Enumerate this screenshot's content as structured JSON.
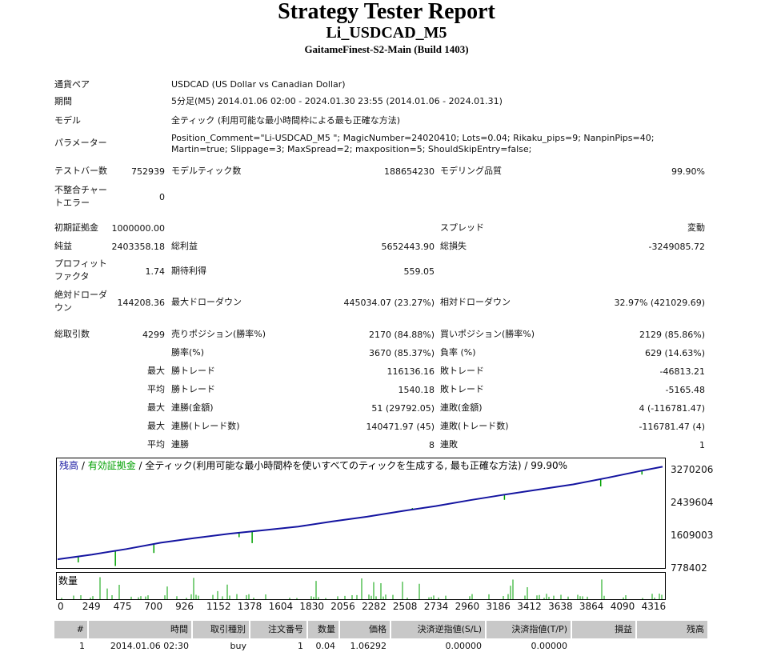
{
  "header": {
    "title": "Strategy Tester Report",
    "subtitle": "Li_USDCAD_M5",
    "server": "GaitameFinest-S2-Main (Build 1403)"
  },
  "info": {
    "symbol_label": "通貨ペア",
    "symbol_value": "USDCAD (US Dollar vs Canadian Dollar)",
    "period_label": "期間",
    "period_value": "5分足(M5) 2014.01.06 02:00 - 2024.01.30 23:55 (2014.01.06 - 2024.01.31)",
    "model_label": "モデル",
    "model_value": "全ティック (利用可能な最小時間枠による最も正確な方法)",
    "params_label": "パラメーター",
    "params_value": "Position_Comment=\"Li-USDCAD_M5 \"; MagicNumber=24020410; Lots=0.04; Rikaku_pips=9; NanpinPips=40; Martin=true; Slippage=3; MaxSpread=2; maxposition=5; ShouldSkipEntry=false;"
  },
  "stats": {
    "bars_label": "テストバー数",
    "bars_value": "752939",
    "ticks_label": "モデルティック数",
    "ticks_value": "188654230",
    "quality_label": "モデリング品質",
    "quality_value": "99.90%",
    "mismatch_label": "不整合チャートエラー",
    "mismatch_value": "0",
    "deposit_label": "初期証拠金",
    "deposit_value": "1000000.00",
    "spread_label": "スプレッド",
    "spread_value": "変動",
    "net_label": "純益",
    "net_value": "2403358.18",
    "gross_profit_label": "総利益",
    "gross_profit_value": "5652443.90",
    "gross_loss_label": "総損失",
    "gross_loss_value": "-3249085.72",
    "pf_label": "プロフィットファクタ",
    "pf_value": "1.74",
    "expected_label": "期待利得",
    "expected_value": "559.05",
    "abs_dd_label": "絶対ドローダウン",
    "abs_dd_value": "144208.36",
    "max_dd_label": "最大ドローダウン",
    "max_dd_value": "445034.07 (23.27%)",
    "rel_dd_label": "相対ドローダウン",
    "rel_dd_value": "32.97% (421029.69)",
    "trades_label": "総取引数",
    "trades_value": "4299",
    "short_label": "売りポジション(勝率%)",
    "short_value": "2170 (84.88%)",
    "long_label": "買いポジション(勝率%)",
    "long_value": "2129 (85.86%)",
    "win_pct_label": "勝率(%)",
    "win_pct_value": "3670 (85.37%)",
    "loss_pct_label": "負率 (%)",
    "loss_pct_value": "629 (14.63%)",
    "max_prefix": "最大",
    "avg_prefix": "平均",
    "largest_win_label": "勝トレード",
    "largest_win_value": "116136.16",
    "largest_loss_label": "敗トレード",
    "largest_loss_value": "-46813.21",
    "avg_win_label": "勝トレード",
    "avg_win_value": "1540.18",
    "avg_loss_label": "敗トレード",
    "avg_loss_value": "-5165.48",
    "max_cons_wins_label": "連勝(金額)",
    "max_cons_wins_value": "51 (29792.05)",
    "max_cons_losses_label": "連敗(金額)",
    "max_cons_losses_value": "4 (-116781.47)",
    "max_cons_profit_label": "連勝(トレード数)",
    "max_cons_profit_value": "140471.97 (45)",
    "max_cons_loss_label": "連敗(トレード数)",
    "max_cons_loss_value": "-116781.47 (4)",
    "avg_cons_wins_label": "連勝",
    "avg_cons_wins_value": "8",
    "avg_cons_losses_label": "連敗",
    "avg_cons_losses_value": "1"
  },
  "chart_data": {
    "type": "line",
    "legend": {
      "balance": "残高",
      "separator": " / ",
      "equity": "有効証拠金",
      "model": " / 全ティック(利用可能な最小時間枠を使いすべてのティックを生成する, 最も正確な方法) / 99.90%"
    },
    "volume_label": "数量",
    "y_ticks": [
      3270206,
      2439604,
      1609003,
      778402
    ],
    "ylim": [
      778402,
      3500000
    ],
    "x_ticks": [
      0,
      249,
      475,
      700,
      926,
      1152,
      1378,
      1604,
      1830,
      2056,
      2282,
      2508,
      2734,
      2960,
      3186,
      3412,
      3638,
      3864,
      4090,
      4316
    ],
    "xlim": [
      0,
      4400
    ],
    "series": [
      {
        "name": "残高",
        "color": "#1414a0",
        "x": [
          0,
          250,
          500,
          750,
          1000,
          1250,
          1500,
          1750,
          2000,
          2250,
          2500,
          2750,
          3000,
          3250,
          3500,
          3750,
          4000,
          4250,
          4400
        ],
        "values": [
          1000000,
          1120000,
          1260000,
          1420000,
          1540000,
          1650000,
          1740000,
          1830000,
          1960000,
          2080000,
          2220000,
          2350000,
          2500000,
          2640000,
          2770000,
          2900000,
          3070000,
          3250000,
          3350000
        ]
      },
      {
        "name": "有効証拠金",
        "color": "#00a000",
        "dips": [
          {
            "x": 150,
            "y": 920000
          },
          {
            "x": 420,
            "y": 830000
          },
          {
            "x": 700,
            "y": 1160000
          },
          {
            "x": 1320,
            "y": 1560000
          },
          {
            "x": 1415,
            "y": 1410000
          },
          {
            "x": 2260,
            "y": 2080000
          },
          {
            "x": 2580,
            "y": 2300000
          },
          {
            "x": 3250,
            "y": 2510000
          },
          {
            "x": 3950,
            "y": 2850000
          },
          {
            "x": 4250,
            "y": 3150000
          }
        ]
      }
    ]
  },
  "trades_table": {
    "headers": [
      "#",
      "時間",
      "取引種別",
      "注文番号",
      "数量",
      "価格",
      "決済逆指値(S/L)",
      "決済指値(T/P)",
      "損益",
      "残高"
    ],
    "first_row": [
      "1",
      "2014.01.06 02:30",
      "buy",
      "1",
      "0.04",
      "1.06292",
      "0.00000",
      "0.00000",
      "",
      ""
    ]
  }
}
